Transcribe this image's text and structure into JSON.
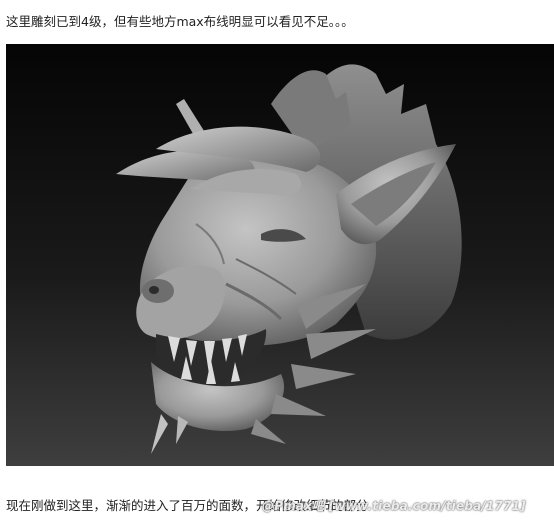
{
  "post": {
    "caption_top": "这里雕刻已到4级，但有些地方max布线明显可以看见不足。。。",
    "caption_bottom": "现在刚做到这里，渐渐的进入了百万的面数，开始修改细节的部分"
  },
  "image": {
    "subject": "dragon-head-sculpt",
    "background_top": "#050505",
    "background_bottom": "#3e3e3e",
    "clay_color": "#9a9a9a"
  },
  "watermark": {
    "text": "@Pmax吧 [www.tieba.com/tieba/1771]"
  }
}
